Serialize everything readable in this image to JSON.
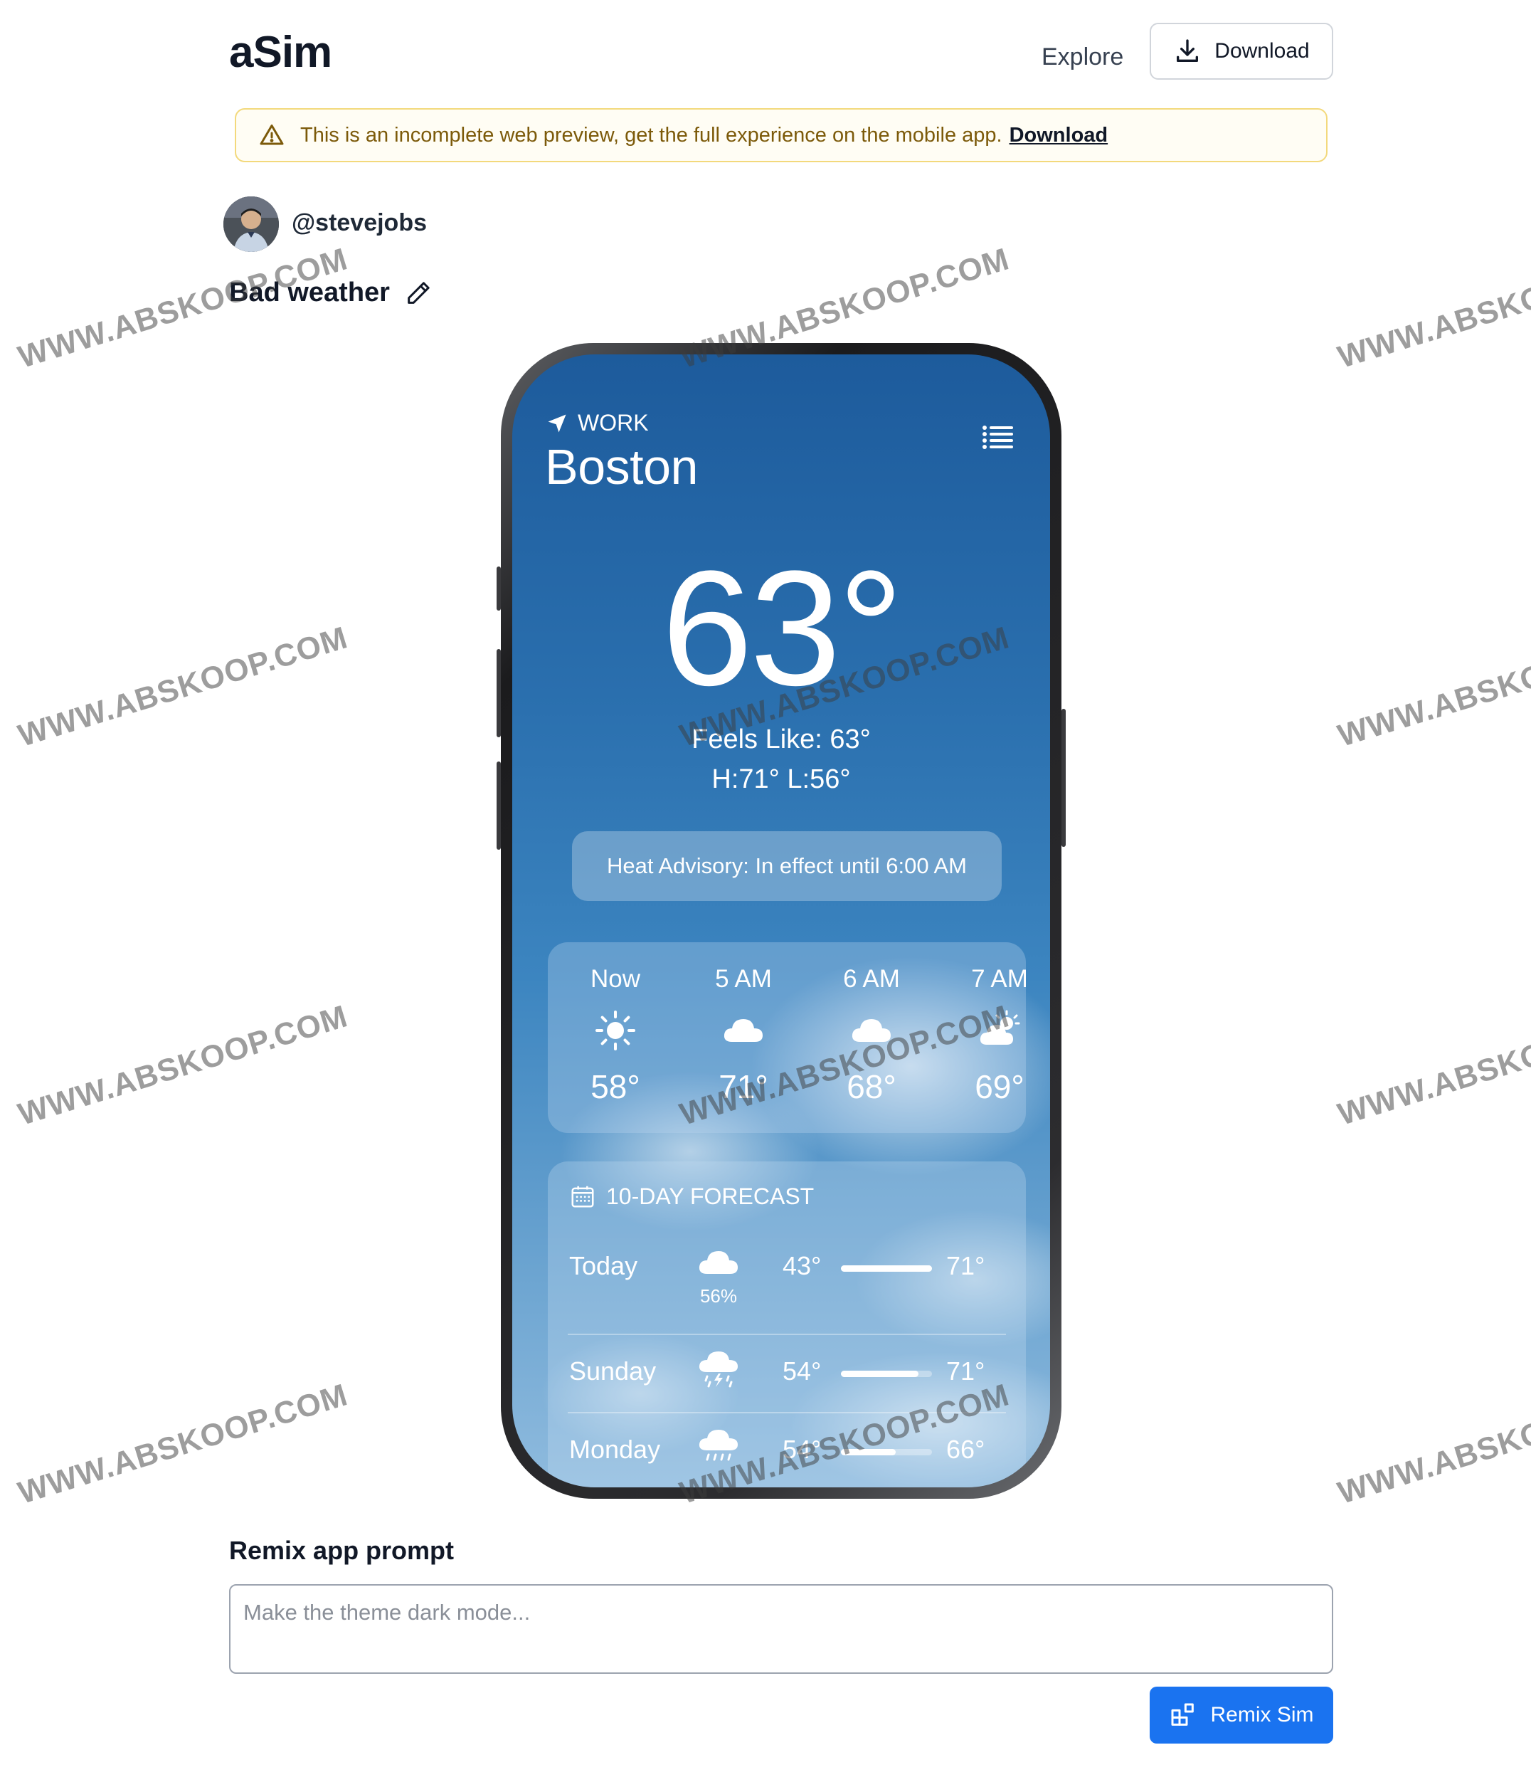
{
  "header": {
    "brand": "aSim",
    "explore_label": "Explore",
    "download_label": "Download"
  },
  "banner": {
    "message": "This is an incomplete web preview, get the full experience on the mobile app.",
    "link_label": "Download"
  },
  "user": {
    "handle": "@stevejobs"
  },
  "sim": {
    "title": "Bad weather"
  },
  "weather_app": {
    "location_tag": "WORK",
    "city": "Boston",
    "current_temp": "63°",
    "feels_like": "Feels Like: 63°",
    "high_low": "H:71° L:56°",
    "advisory": "Heat Advisory: In effect until 6:00 AM",
    "hourly": [
      {
        "label": "Now",
        "icon": "sun-icon",
        "temp": "58°"
      },
      {
        "label": "5 AM",
        "icon": "cloud-icon",
        "temp": "71°"
      },
      {
        "label": "6 AM",
        "icon": "cloud-icon",
        "temp": "68°"
      },
      {
        "label": "7 AM",
        "icon": "partly-sunny-icon",
        "temp": "69°"
      }
    ],
    "forecast_title": "10-DAY FORECAST",
    "forecast": [
      {
        "day": "Today",
        "icon": "cloud-icon",
        "precip": "56%",
        "low": "43°",
        "high": "71°",
        "bar_start": 0.0,
        "bar_end": 1.0
      },
      {
        "day": "Sunday",
        "icon": "thunderstorm-icon",
        "precip": "",
        "low": "54°",
        "high": "71°",
        "bar_start": 0.0,
        "bar_end": 0.85
      },
      {
        "day": "Monday",
        "icon": "rain-icon",
        "precip": "",
        "low": "54°",
        "high": "66°",
        "bar_start": 0.0,
        "bar_end": 0.6
      }
    ]
  },
  "remix": {
    "label": "Remix app prompt",
    "placeholder": "Make the theme dark mode...",
    "button_label": "Remix Sim"
  },
  "watermark": "WWW.ABSKOOP.COM",
  "colors": {
    "primary_button": "#1a73f0",
    "banner_border": "#f3d97c",
    "banner_text": "#7c5a0a"
  }
}
